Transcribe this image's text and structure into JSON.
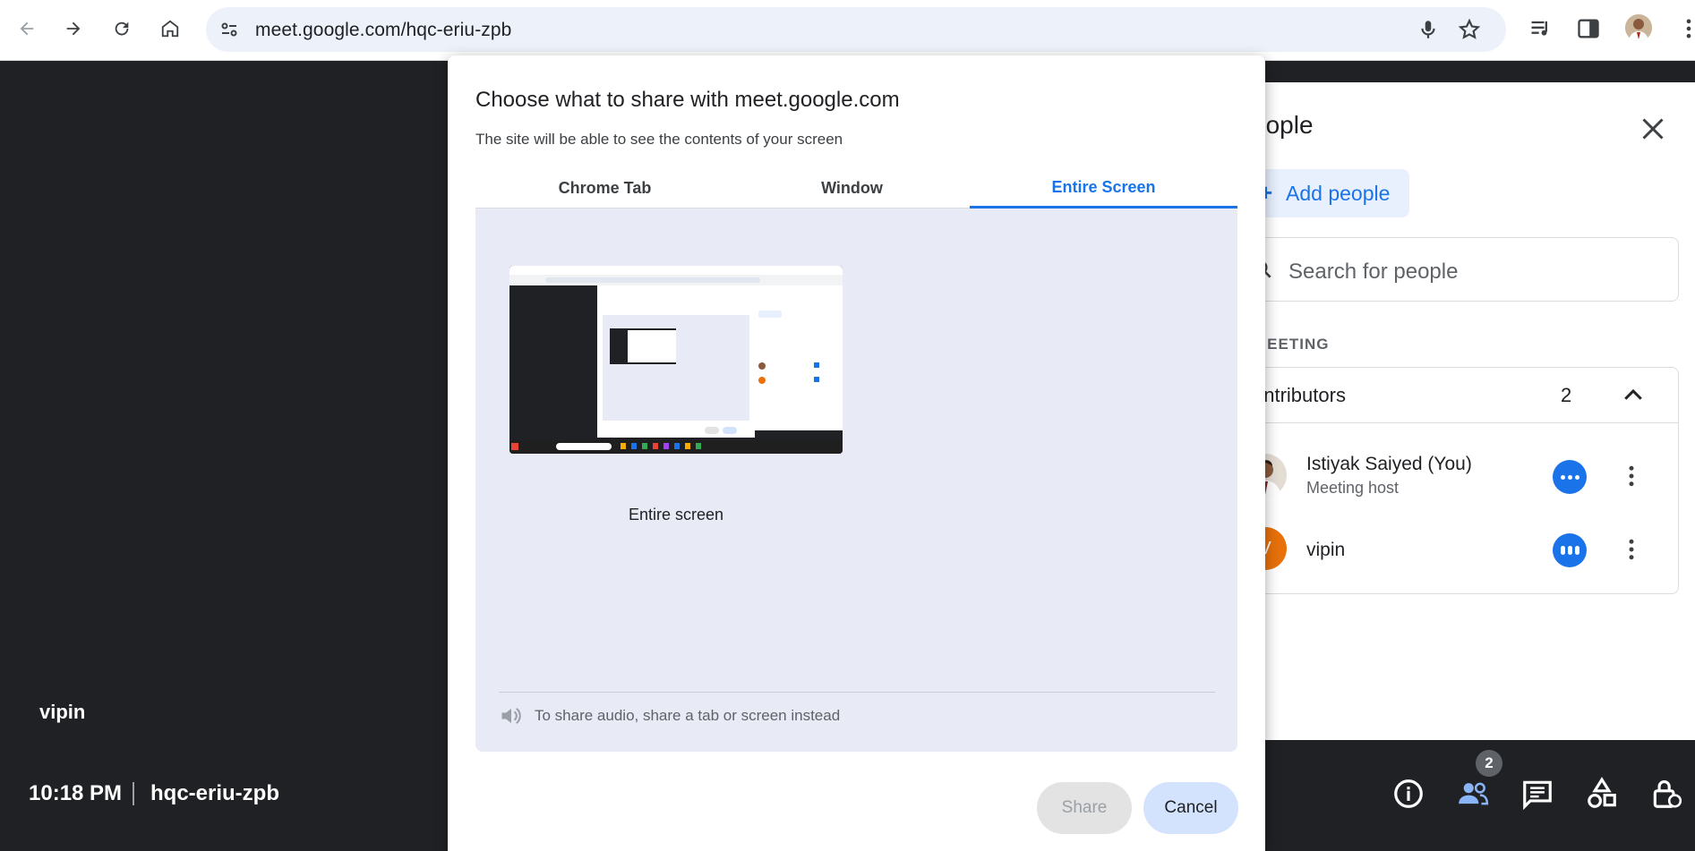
{
  "browser": {
    "url": "meet.google.com/hqc-eriu-zpb"
  },
  "meet": {
    "tile_name": "vipin",
    "time": "10:18 PM",
    "meeting_code": "hqc-eriu-zpb",
    "people_badge_count": "2"
  },
  "people_panel": {
    "title": "eople",
    "add_label": "Add people",
    "search_placeholder": "Search for people",
    "section_label": "MEETING",
    "group_name": "ontributors",
    "group_count": "2",
    "people": [
      {
        "name": "Istiyak Saiyed (You)",
        "role": "Meeting host"
      },
      {
        "name": "vipin",
        "initial": "V"
      }
    ]
  },
  "dialog": {
    "title": "Choose what to share with meet.google.com",
    "subtitle": "The site will be able to see the contents of your screen",
    "tabs": [
      "Chrome Tab",
      "Window",
      "Entire Screen"
    ],
    "active_tab": "Entire Screen",
    "source_caption": "Entire screen",
    "audio_note": "To share audio, share a tab or screen instead",
    "share_label": "Share",
    "cancel_label": "Cancel"
  },
  "colors": {
    "accent": "#1a73e8",
    "meet_bg": "#202124",
    "vipin_avatar": "#e8710a"
  }
}
